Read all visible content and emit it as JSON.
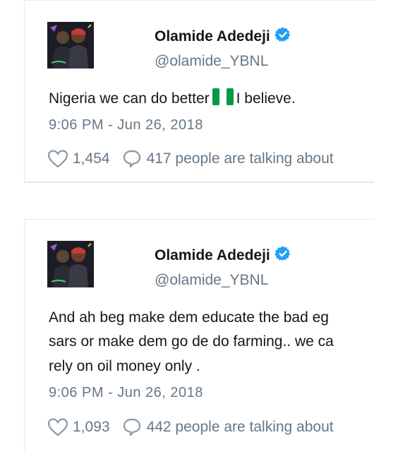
{
  "tweets": [
    {
      "name": "Olamide Adedeji",
      "handle": "@olamide_YBNL",
      "text_before_flag": "Nigeria we can do better",
      "text_after_flag": "I believe.",
      "time": "9:06 PM - Jun 26, 2018",
      "likes": "1,454",
      "replies": "417 people are talking about"
    },
    {
      "name": "Olamide Adedeji",
      "handle": "@olamide_YBNL",
      "lines": [
        "And ah beg make dem educate the bad eg",
        "sars or make dem go de do farming.. we ca",
        "rely on oil money only ."
      ],
      "time": "9:06 PM - Jun 26, 2018",
      "likes": "1,093",
      "replies": "442 people are talking about"
    }
  ],
  "colors": {
    "accent": "#1da1f2",
    "muted": "#657786",
    "text": "#14171a",
    "flag_green": "#009a49"
  },
  "icons": [
    "verified-badge-icon",
    "heart-icon",
    "reply-bubble-icon",
    "nigeria-flag-icon"
  ]
}
